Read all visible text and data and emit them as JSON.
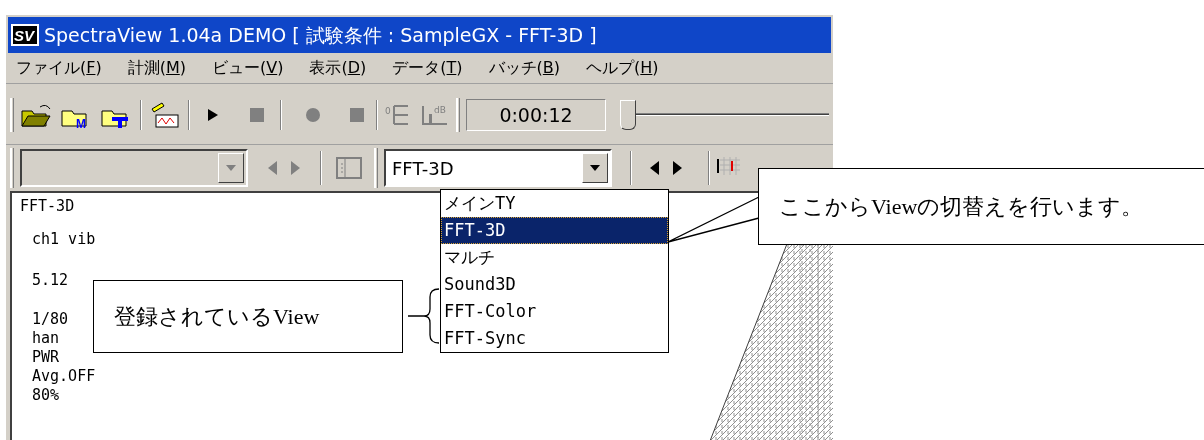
{
  "window": {
    "logo": "SV",
    "title": "SpectraView 1.04a DEMO [ 試験条件 : SampleGX - FFT-3D ]"
  },
  "menu": [
    {
      "label": "ファイル(F)"
    },
    {
      "label": "計測(M)"
    },
    {
      "label": "ビュー(V)"
    },
    {
      "label": "表示(D)"
    },
    {
      "label": "データ(T)"
    },
    {
      "label": "バッチ(B)"
    },
    {
      "label": "ヘルプ(H)"
    }
  ],
  "toolbar": {
    "open_m_mark": "M",
    "zero_scale_mark": "0",
    "db_scale_mark": "dB",
    "time": "0:00:12",
    "slider": {
      "level": 0
    }
  },
  "view_selector": {
    "value": "FFT-3D",
    "options": [
      {
        "label": "メインTY",
        "selected": false
      },
      {
        "label": "FFT-3D",
        "selected": true
      },
      {
        "label": "マルチ",
        "selected": false
      },
      {
        "label": "Sound3D",
        "selected": false
      },
      {
        "label": "FFT-Color",
        "selected": false
      },
      {
        "label": "FFT-Sync",
        "selected": false
      }
    ]
  },
  "info_lines": [
    "FFT-3D",
    "ch1 vib",
    "5.12",
    "1/80",
    "han",
    "PWR",
    "Avg.OFF",
    "80%"
  ],
  "callouts": [
    {
      "text": "登録されているView"
    },
    {
      "text": "ここからViewの切替えを行います。"
    }
  ]
}
